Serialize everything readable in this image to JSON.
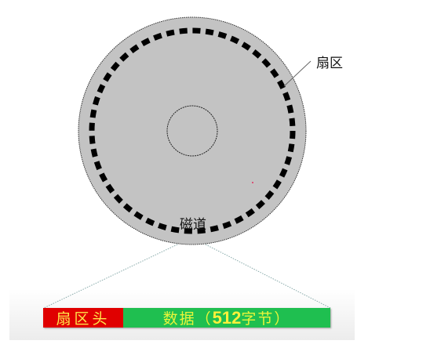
{
  "labels": {
    "sector": "扇区",
    "track": "磁道"
  },
  "sector_bar": {
    "header": "扇区头",
    "data_prefix": "数据（",
    "data_size": "512",
    "data_suffix": "字节）"
  },
  "colors": {
    "disk": "#c3c3c3",
    "header": "#e00000",
    "data": "#1fbf50",
    "text": "#ffe54a"
  }
}
